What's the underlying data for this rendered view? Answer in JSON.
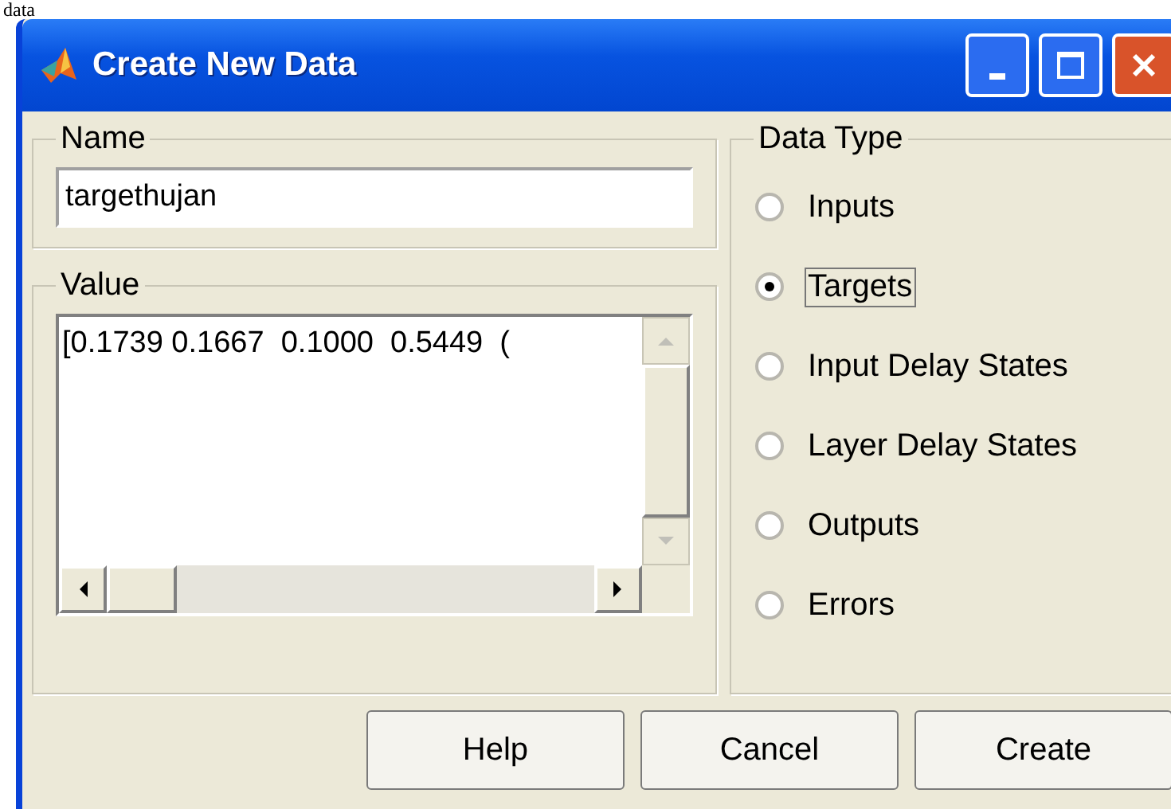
{
  "caption": "data",
  "window": {
    "title": "Create New Data"
  },
  "name_group": {
    "label": "Name",
    "value": "targethujan"
  },
  "value_group": {
    "label": "Value",
    "value": "[0.1739 0.1667  0.1000  0.5449  ("
  },
  "data_type": {
    "label": "Data Type",
    "options": [
      {
        "label": "Inputs",
        "selected": false
      },
      {
        "label": "Targets",
        "selected": true
      },
      {
        "label": "Input Delay States",
        "selected": false
      },
      {
        "label": "Layer Delay States",
        "selected": false
      },
      {
        "label": "Outputs",
        "selected": false
      },
      {
        "label": "Errors",
        "selected": false
      }
    ]
  },
  "buttons": [
    "Help",
    "Cancel",
    "Create"
  ]
}
